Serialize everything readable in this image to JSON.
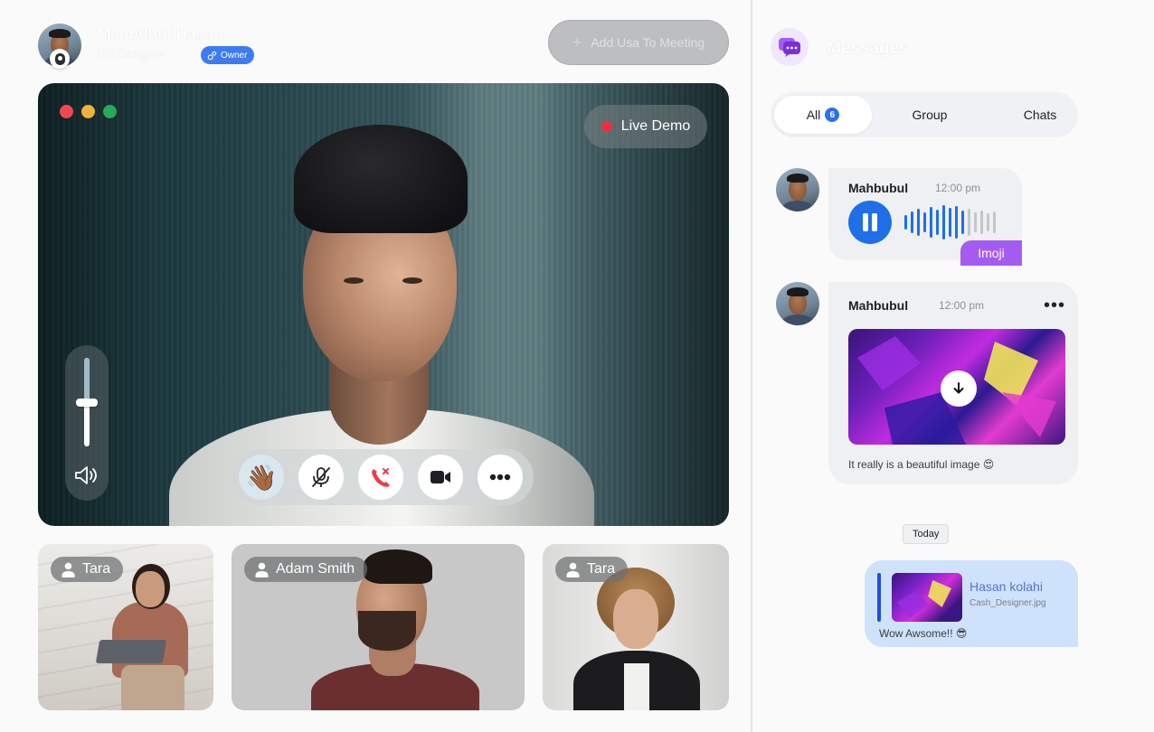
{
  "header": {
    "host_name": "Mahbubul Hasan",
    "host_role": "UX Designer",
    "owner_label": "Owner",
    "add_button_label": "Add Usa To Meeting"
  },
  "main_video": {
    "live_label": "Live Demo",
    "volume_level": 0.5,
    "reaction_emoji": "👋🏾"
  },
  "participants": [
    {
      "name": "Tara"
    },
    {
      "name": "Adam Smith"
    },
    {
      "name": "Tara"
    }
  ],
  "messages_panel": {
    "title": "Messages",
    "tabs": [
      {
        "label": "All",
        "count": "6"
      },
      {
        "label": "Group"
      },
      {
        "label": "Chats"
      }
    ],
    "voice_message": {
      "sender": "Mahbubul",
      "time": "12:00 pm",
      "tag": "Imoji"
    },
    "image_message": {
      "sender": "Mahbubul",
      "time": "12:00 pm",
      "caption": "It really is a beautiful image 😍"
    },
    "date_divider": "Today",
    "outgoing": {
      "reply_name": "Hasan kolahi",
      "reply_file": "Cash_Designer.jpg",
      "text": "Wow Awsome!! 😎"
    }
  },
  "colors": {
    "accent_blue": "#1f6fe6",
    "accent_purple": "#a45cf0",
    "live_red": "#f0303a"
  },
  "icons": [
    "camera-icon",
    "owner-icon",
    "plus-icon",
    "volume-icon",
    "mic-off-icon",
    "end-call-icon",
    "video-icon",
    "more-icon",
    "user-icon",
    "messages-icon",
    "pause-icon",
    "download-icon"
  ]
}
